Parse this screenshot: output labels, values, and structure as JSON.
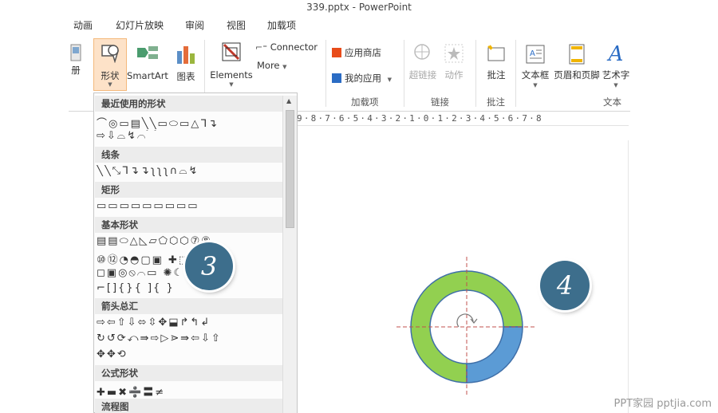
{
  "window": {
    "title": "339.pptx - PowerPoint"
  },
  "tabs": [
    "动画",
    "幻灯片放映",
    "审阅",
    "视图",
    "加载项"
  ],
  "ribbon": {
    "partial_label": "册",
    "shapes_label": "形状",
    "smartart_label": "SmartArt",
    "chart_label": "图表",
    "elements_label": "Elements",
    "connector_label": "Connector",
    "more_label": "More",
    "store_label": "应用商店",
    "myapps_label": "我的应用",
    "addins_group": "加载项",
    "hyperlink_label": "超链接",
    "action_label": "动作",
    "links_group": "链接",
    "comment_label": "批注",
    "comments_group": "批注",
    "textbox_label": "文本框",
    "headerfooter_label": "页眉和页脚",
    "wordart_label": "艺术字",
    "text_group": "文本"
  },
  "shapes_panel": {
    "categories": {
      "recent": "最近使用的形状",
      "lines": "线条",
      "rect": "矩形",
      "basic": "基本形状",
      "arrows": "箭头总汇",
      "equation": "公式形状",
      "flowchart": "流程图"
    },
    "rows": {
      "recent_1": "⌒◎▭▤╲╲▭⬭▭△ᒣ↴",
      "recent_2": "⇨⇩⌓↯⌒⁀",
      "lines_1": "╲╲⤡ᒣ↴↴ʅʅʅ∩⌓↯",
      "rect_1": "▭▭▭▭▭▭▭▭▭",
      "basic_1": "▤▤⬭△◺▱⬠⬡⬡⑦⑧",
      "basic_2": "⑩⑫◔◓▢▣     ✚⬚⌸",
      "basic_3": "◻▣◎⦸⌒▭    ✺☾☁",
      "basic_4": "⌐[]{}{ ]{ }",
      "arrows_1": "⇨⇦⇧⇩⬄⇳✥⬓↱↰↲",
      "arrows_2": "↻↺⟳⤺⇛⇨▷⋗⇛⇦⇩⇧",
      "arrows_3": "✥✥⟲",
      "equation_1": "✚▬✖➗〓≠"
    }
  },
  "ruler_text": "9·8·7·6·5·4·3·2·1·0·1·2·3·4·5·6·7·8",
  "badges": {
    "left": "3",
    "right": "4"
  },
  "chart_data": {
    "type": "pie",
    "style": "donut",
    "categories": [
      "",
      ""
    ],
    "values": [
      75,
      25
    ],
    "colors": [
      "#92d050",
      "#5b9bd5"
    ]
  },
  "watermark": "PPT家园 pptjia.com"
}
